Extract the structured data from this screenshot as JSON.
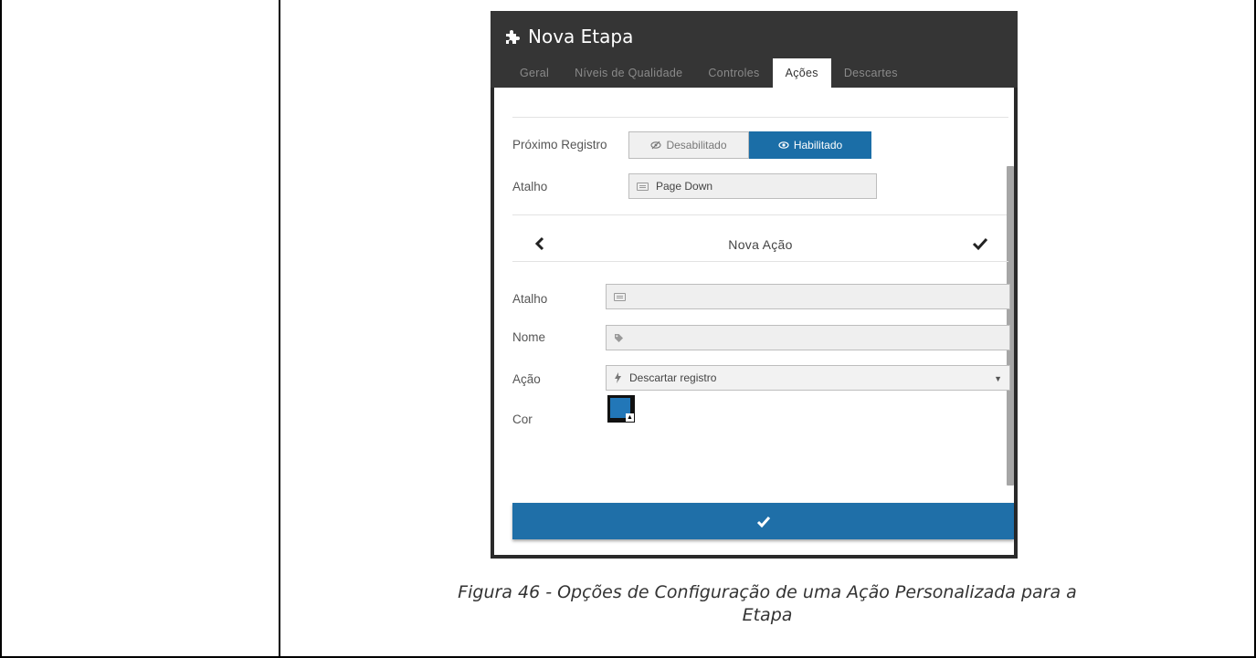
{
  "dialog": {
    "title": "Nova Etapa",
    "tabs": [
      {
        "label": "Geral",
        "active": false
      },
      {
        "label": "Níveis de Qualidade",
        "active": false
      },
      {
        "label": "Controles",
        "active": false
      },
      {
        "label": "Ações",
        "active": true
      },
      {
        "label": "Descartes",
        "active": false
      }
    ]
  },
  "next_record": {
    "label": "Próximo Registro",
    "option_disabled": "Desabilitado",
    "option_enabled": "Habilitado",
    "selected": "Habilitado"
  },
  "shortcut": {
    "label": "Atalho",
    "value": "Page Down"
  },
  "new_action": {
    "title": "Nova Ação",
    "shortcut_label": "Atalho",
    "shortcut_value": "",
    "name_label": "Nome",
    "name_value": "",
    "action_label": "Ação",
    "action_value": "Descartar registro",
    "color_label": "Cor",
    "color_value": "#2277b8"
  },
  "colors": {
    "header_bg": "#353535",
    "accent": "#1b6ea7"
  },
  "caption": {
    "line1": "Figura 46 - Opções de Configuração de uma Ação Personalizada para a",
    "line2": "Etapa"
  }
}
